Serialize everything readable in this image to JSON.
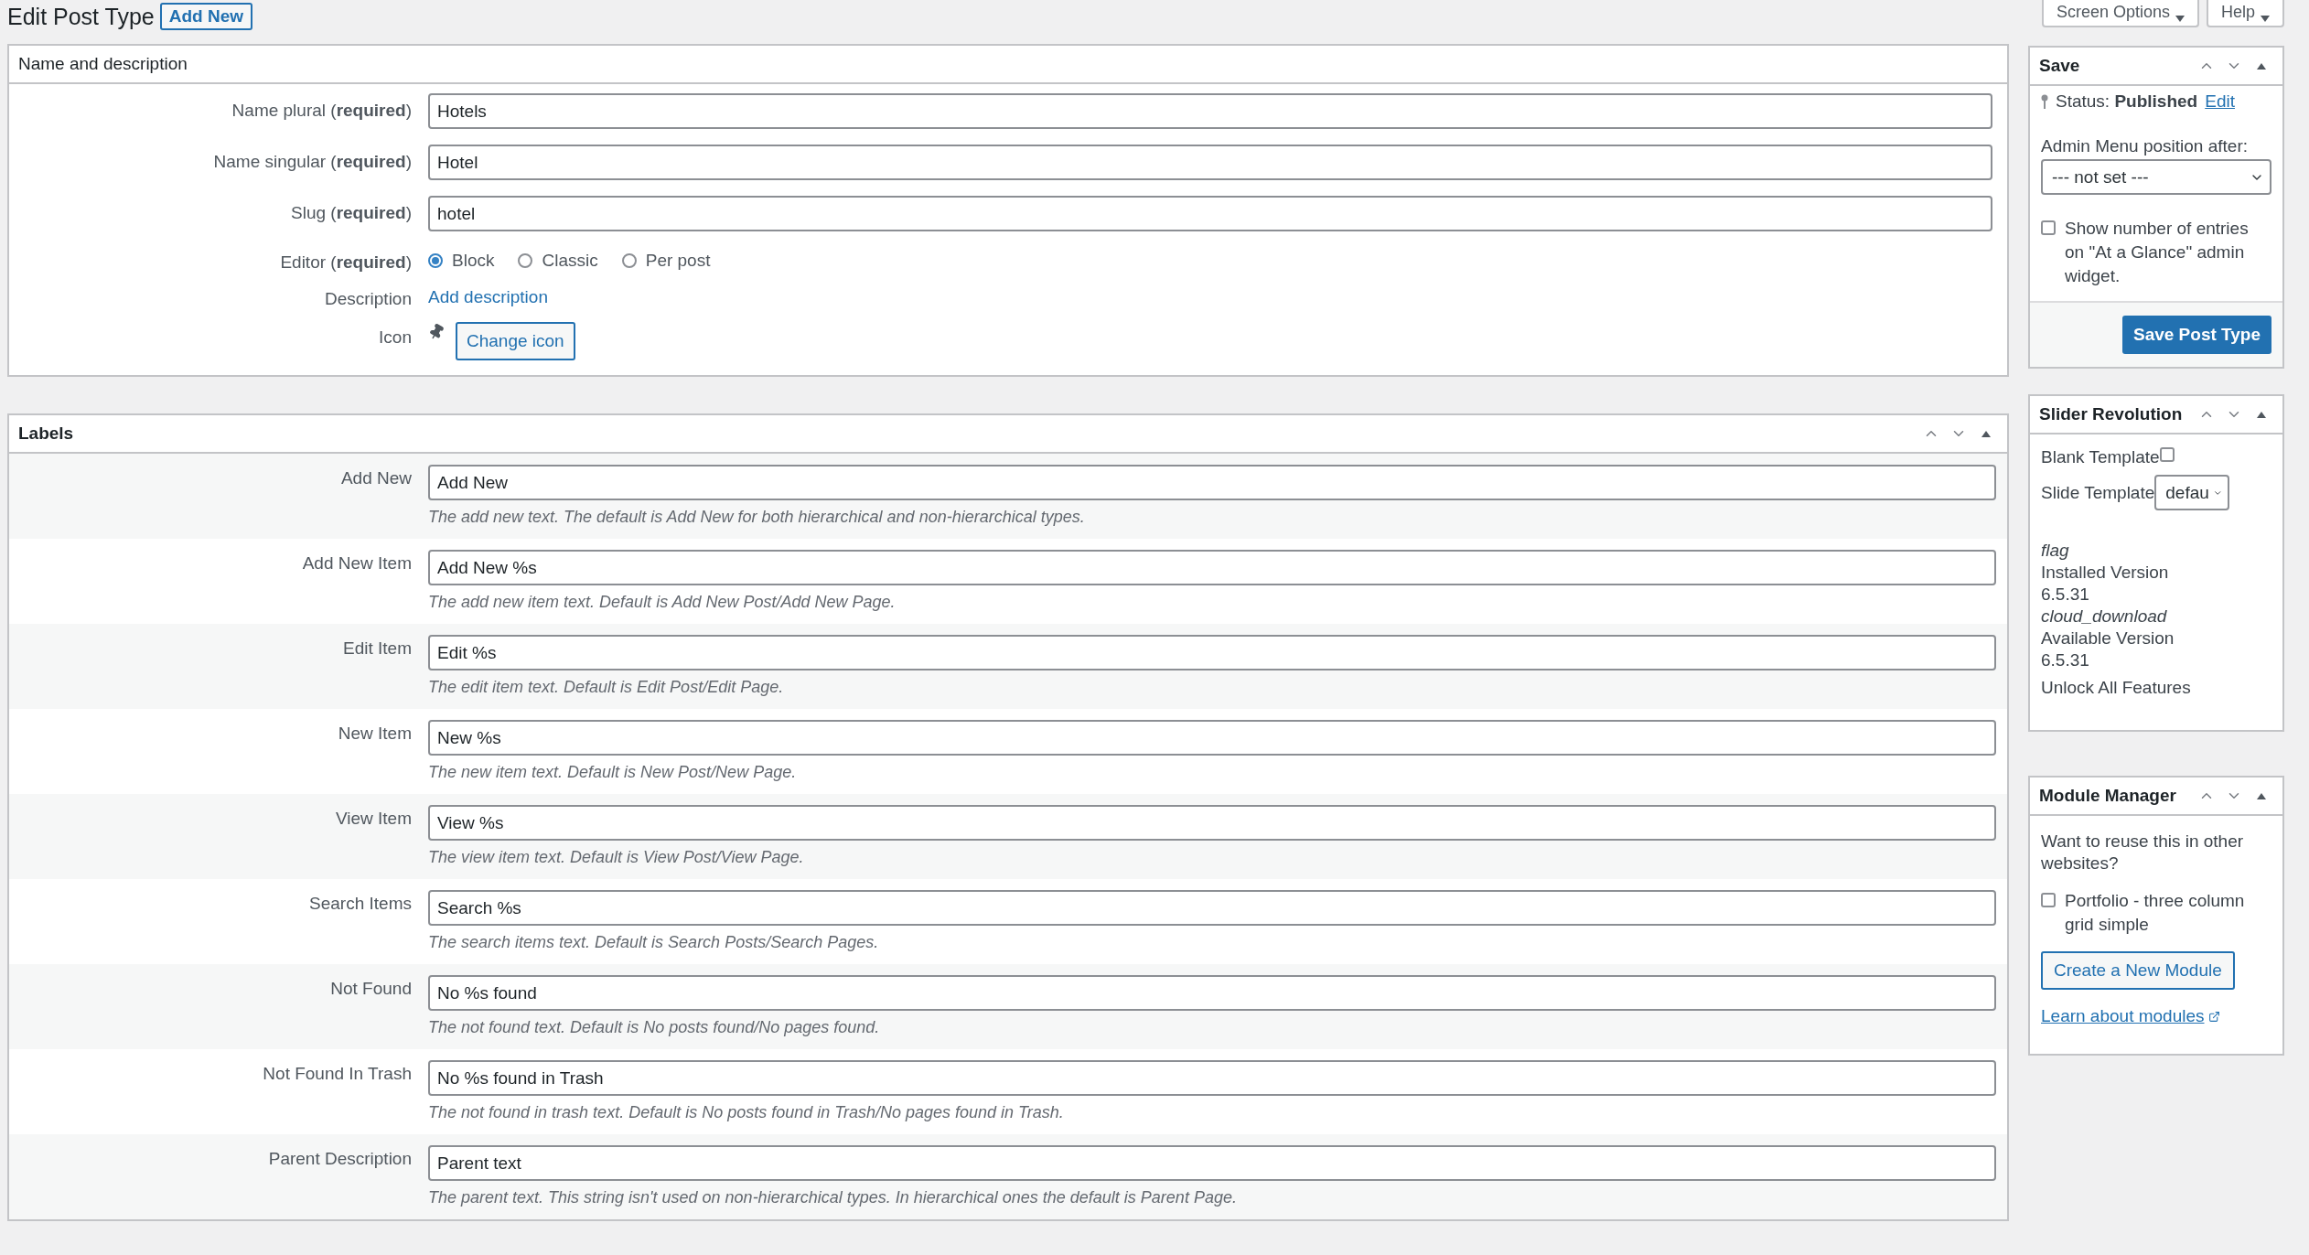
{
  "header": {
    "title": "Edit Post Type",
    "add_new": "Add New",
    "screen_options": "Screen Options",
    "help": "Help"
  },
  "name_panel": {
    "title": "Name and description",
    "fields": [
      {
        "kind": "text",
        "label": "Name plural (**required**)",
        "value": "Hotels"
      },
      {
        "kind": "text",
        "label": "Name singular (**required**)",
        "value": "Hotel"
      },
      {
        "kind": "text",
        "label": "Slug (**required**)",
        "value": "hotel"
      },
      {
        "kind": "radio",
        "label": "Editor (**required**)",
        "options": [
          {
            "label": "Block",
            "selected": true
          },
          {
            "label": "Classic",
            "selected": false
          },
          {
            "label": "Per post",
            "selected": false
          }
        ]
      },
      {
        "kind": "link",
        "label": "Description",
        "link": "Add description"
      },
      {
        "kind": "icon",
        "label": "Icon",
        "button": "Change icon"
      }
    ]
  },
  "labels_panel": {
    "title": "Labels",
    "rows": [
      {
        "label": "Add New",
        "value": "Add New",
        "help": "The add new text. The default is Add New for both hierarchical and non-hierarchical types."
      },
      {
        "label": "Add New Item",
        "value": "Add New %s",
        "help": "The add new item text. Default is Add New Post/Add New Page."
      },
      {
        "label": "Edit Item",
        "value": "Edit %s",
        "help": "The edit item text. Default is Edit Post/Edit Page."
      },
      {
        "label": "New Item",
        "value": "New %s",
        "help": "The new item text. Default is New Post/New Page."
      },
      {
        "label": "View Item",
        "value": "View %s",
        "help": "The view item text. Default is View Post/View Page."
      },
      {
        "label": "Search Items",
        "value": "Search %s",
        "help": "The search items text. Default is Search Posts/Search Pages."
      },
      {
        "label": "Not Found",
        "value": "No %s found",
        "help": "The not found text. Default is No posts found/No pages found."
      },
      {
        "label": "Not Found In Trash",
        "value": "No %s found in Trash",
        "help": "The not found in trash text. Default is No posts found in Trash/No pages found in Trash."
      },
      {
        "label": "Parent Description",
        "value": "Parent text",
        "help": "The parent text. This string isn't used on non-hierarchical types. In hierarchical ones the default is Parent Page."
      }
    ]
  },
  "sidebar": {
    "save": {
      "title": "Save",
      "status": "Status: **Published**",
      "status_link": "Edit",
      "menu_position_label": "Admin Menu position after:",
      "menu_position_value": "--- not set ---",
      "show_count": {
        "label": "Show number of entries on \"At a Glance\" admin widget.",
        "checked": false
      },
      "button": "Save Post Type"
    },
    "slider_revolution": {
      "title": "Slider Revolution",
      "blank_template": {
        "label": "Blank Template",
        "checked": false
      },
      "slide_template": {
        "label": "Slide Template",
        "value": "defau"
      },
      "lines": [
        {
          "kind": "icon_name",
          "text": "flag"
        },
        {
          "kind": "text",
          "text": "Installed Version"
        },
        {
          "kind": "text",
          "text": "6.5.31"
        },
        {
          "kind": "icon_name",
          "text": "cloud_download"
        },
        {
          "kind": "text",
          "text": "Available Version"
        },
        {
          "kind": "text",
          "text": "6.5.31"
        },
        {
          "kind": "action",
          "text": "Unlock All Features"
        }
      ]
    },
    "module_manager": {
      "title": "Module Manager",
      "question": "Want to reuse this in other websites?",
      "module": {
        "label": "Portfolio - three column grid simple",
        "checked": false
      },
      "button": "Create a New Module",
      "link": "Learn about modules"
    }
  }
}
